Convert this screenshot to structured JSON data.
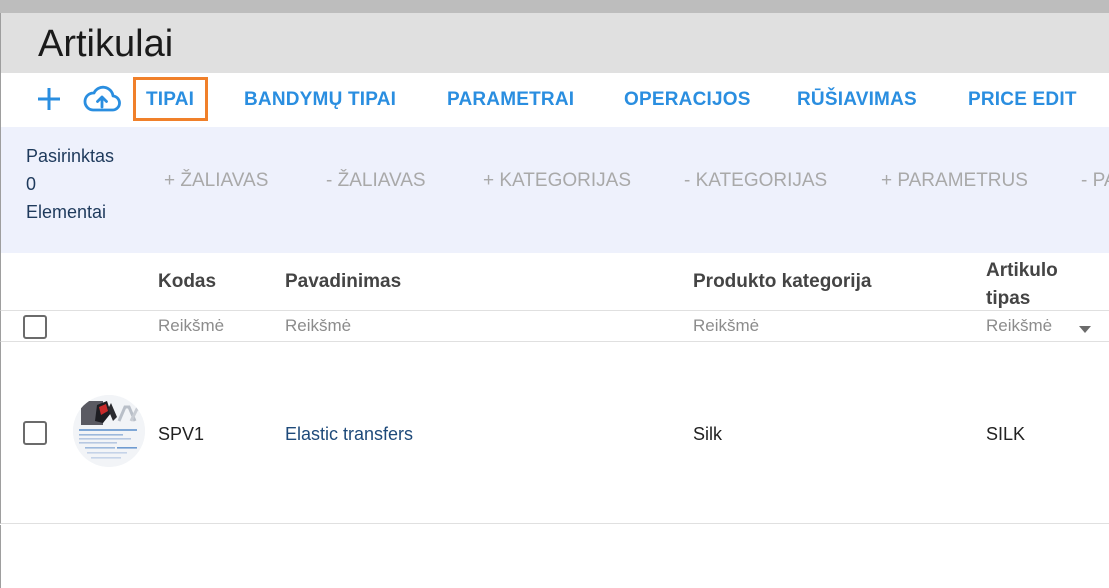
{
  "header": {
    "title": "Artikulai"
  },
  "toolbar": {
    "add_icon": "plus-icon",
    "upload_icon": "cloud-upload-icon",
    "tabs": [
      {
        "label": "TIPAI",
        "highlighted": true
      },
      {
        "label": "BANDYMŲ TIPAI"
      },
      {
        "label": "PARAMETRAI"
      },
      {
        "label": "OPERACIJOS"
      },
      {
        "label": "RŪŠIAVIMAS"
      },
      {
        "label": "PRICE EDIT"
      }
    ],
    "accent_color": "#2a8ee0",
    "highlight_color": "#f0802a"
  },
  "selection": {
    "label_top": "Pasirinktas",
    "count": "0",
    "label_bottom": "Elementai",
    "actions": [
      "+ ŽALIAVAS",
      "- ŽALIAVAS",
      "+ KATEGORIJAS",
      "- KATEGORIJAS",
      "+ PARAMETRUS",
      "- PA"
    ]
  },
  "table": {
    "columns": [
      {
        "label": "Kodas",
        "filter_placeholder": "Reikšmė"
      },
      {
        "label": "Pavadinimas",
        "filter_placeholder": "Reikšmė"
      },
      {
        "label": "Produkto kategorija",
        "filter_placeholder": "Reikšmė"
      },
      {
        "label_line1": "Artikulo",
        "label_line2": "tipas",
        "filter_placeholder": "Reikšmė",
        "filter_icon": "dropdown-arrow-icon"
      }
    ],
    "rows": [
      {
        "code": "SPV1",
        "name": "Elastic transfers",
        "category": "Silk",
        "type": "SILK"
      }
    ]
  }
}
